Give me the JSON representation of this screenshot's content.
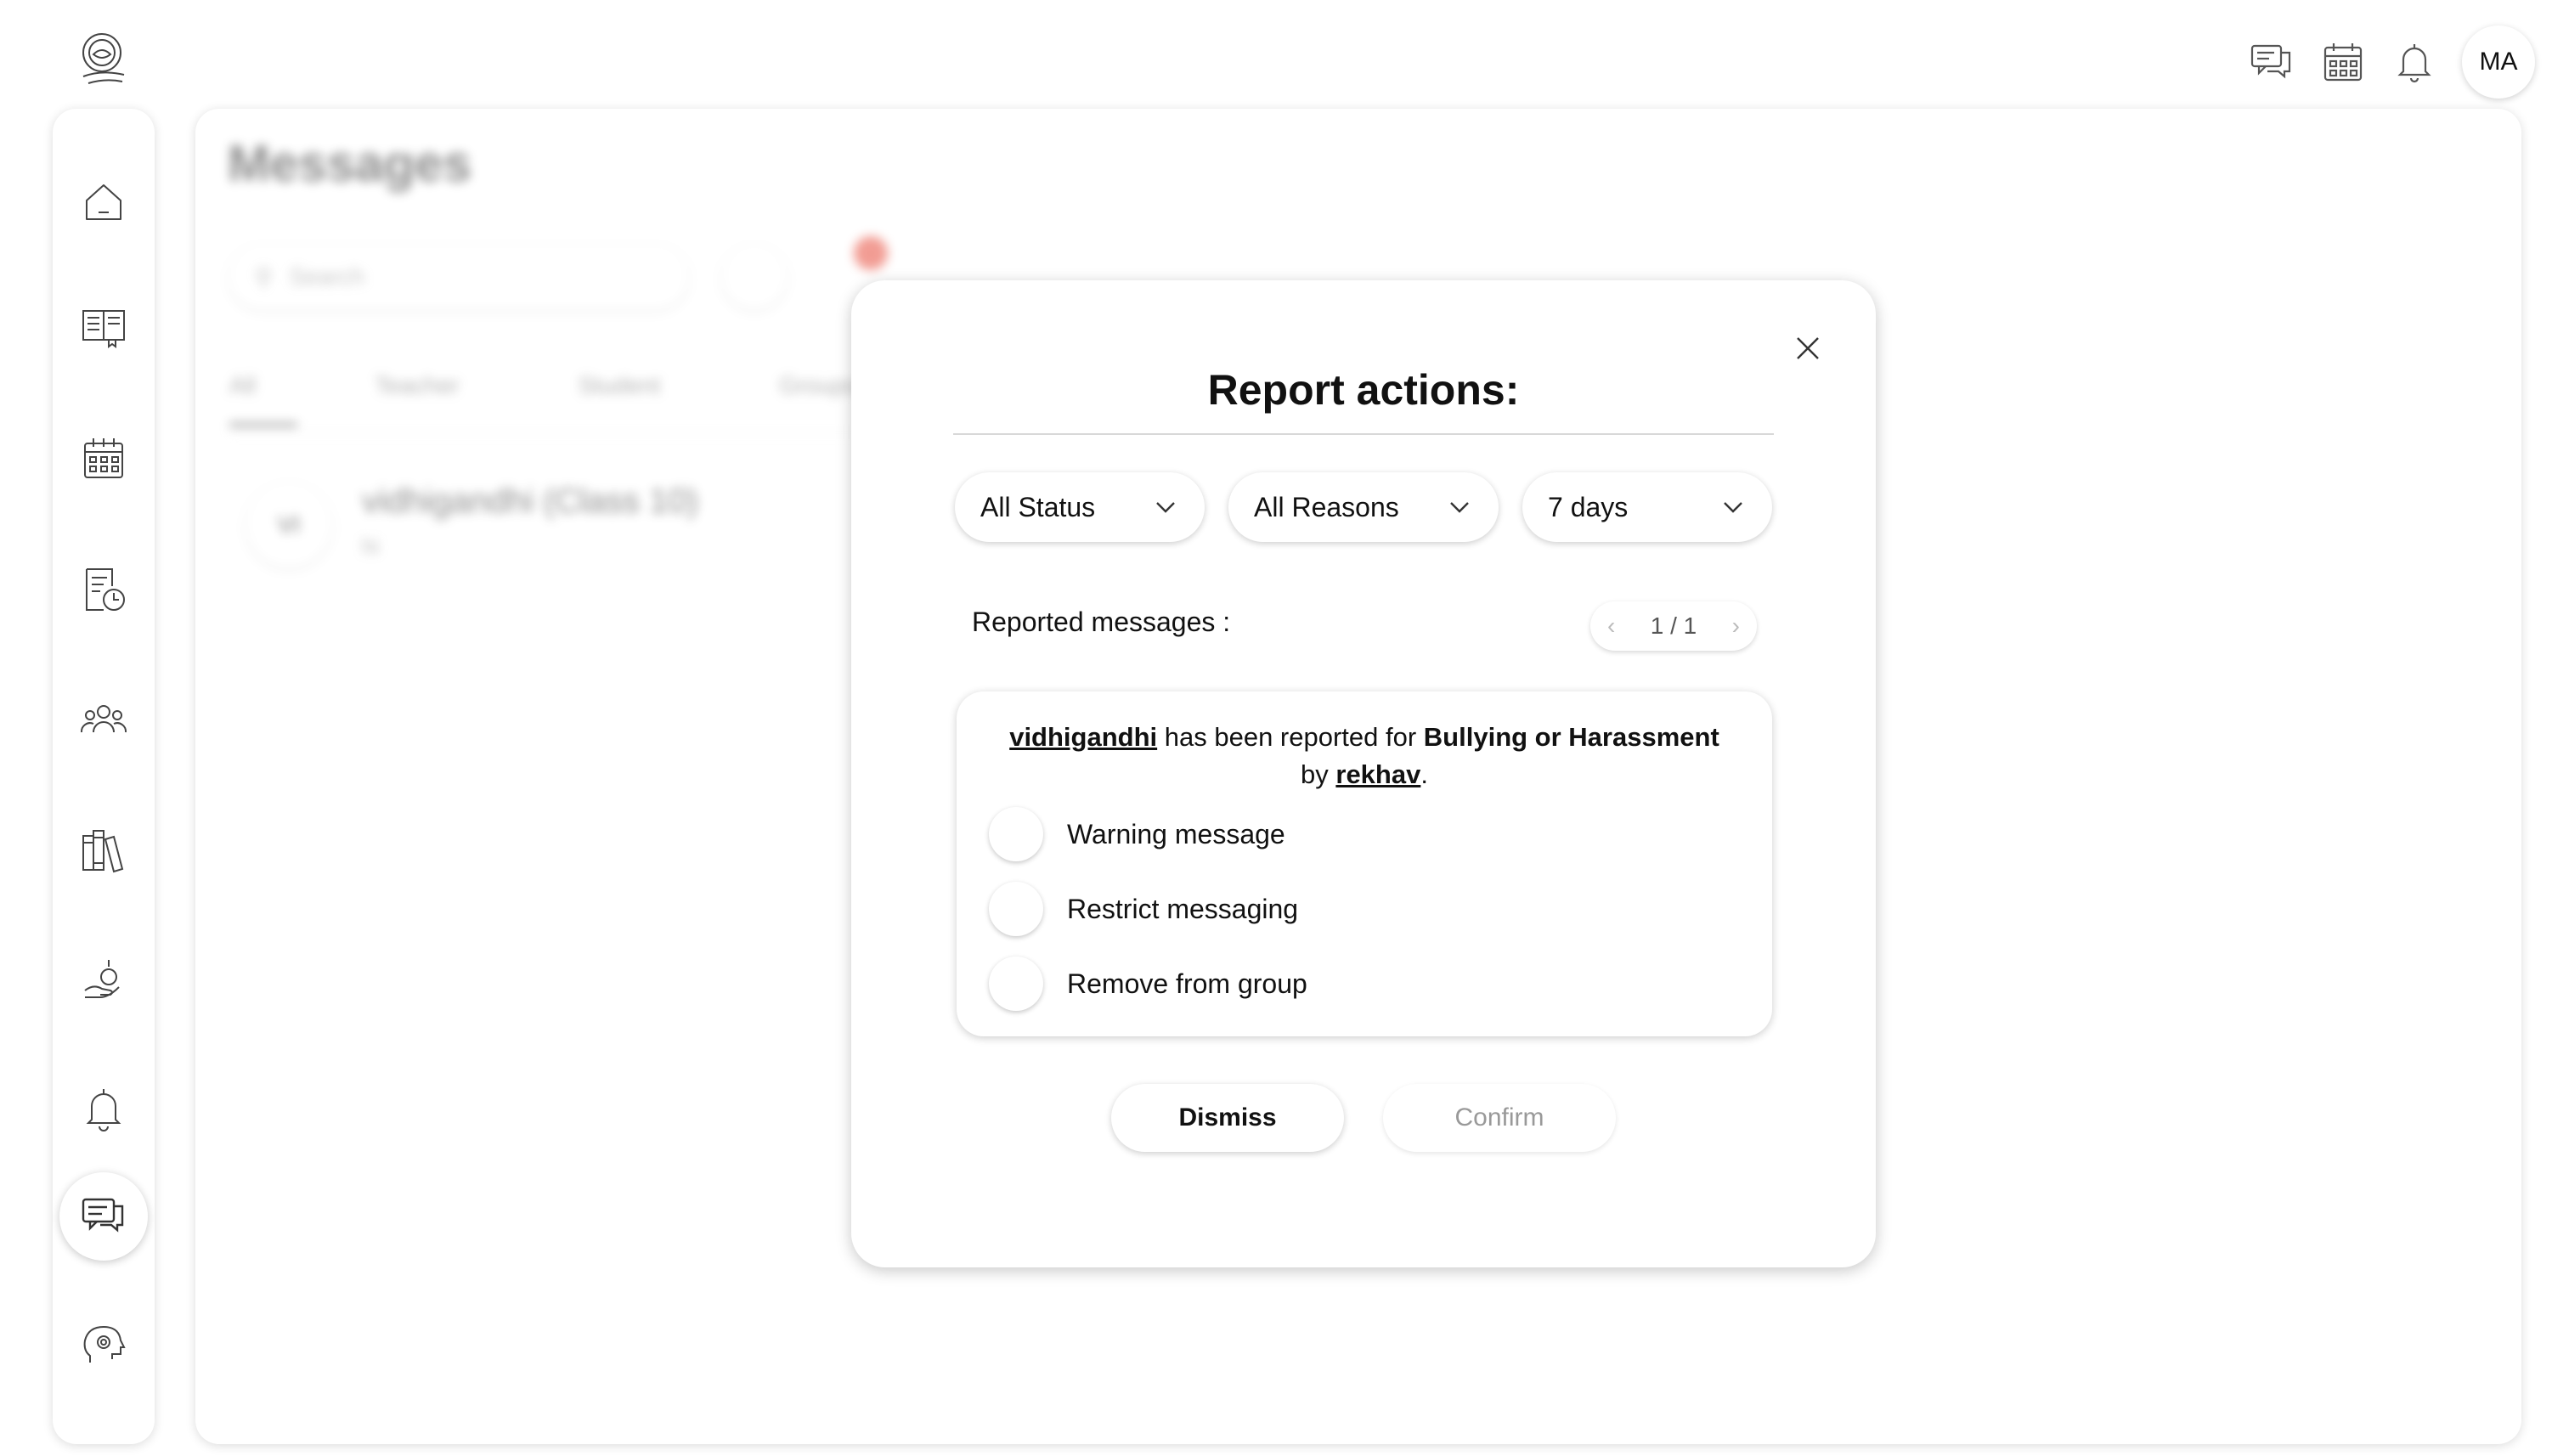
{
  "header": {
    "avatar_initials": "MA",
    "icons": [
      "chat-icon",
      "calendar-icon",
      "bell-icon"
    ]
  },
  "sidebar": {
    "items": [
      {
        "icon": "home-icon"
      },
      {
        "icon": "book-icon"
      },
      {
        "icon": "calendar-icon"
      },
      {
        "icon": "schedule-icon"
      },
      {
        "icon": "users-icon"
      },
      {
        "icon": "library-icon"
      },
      {
        "icon": "donation-icon"
      },
      {
        "icon": "bell-icon"
      },
      {
        "icon": "messages-icon",
        "active": true
      },
      {
        "icon": "brain-icon"
      }
    ]
  },
  "background": {
    "page_title": "Messages",
    "search_placeholder": "Search",
    "tabs": [
      "All",
      "Teacher",
      "Student",
      "Groups"
    ],
    "row_avatar": "VI",
    "row_name": "vidhigandhi (Class 10)",
    "row_sub": "hi"
  },
  "modal": {
    "title": "Report actions:",
    "filters": {
      "status": "All Status",
      "reasons": "All Reasons",
      "period": "7 days"
    },
    "reported_label": "Reported messages :",
    "pager": "1 / 1",
    "report": {
      "reported_user": "vidhigandhi",
      "text_mid": " has been reported for ",
      "reason": "Bullying or Harassment",
      "text_by": " by ",
      "reporter": "rekhav",
      "text_end": "."
    },
    "options": [
      "Warning message",
      "Restrict messaging",
      "Remove from group"
    ],
    "dismiss_label": "Dismiss",
    "confirm_label": "Confirm"
  }
}
